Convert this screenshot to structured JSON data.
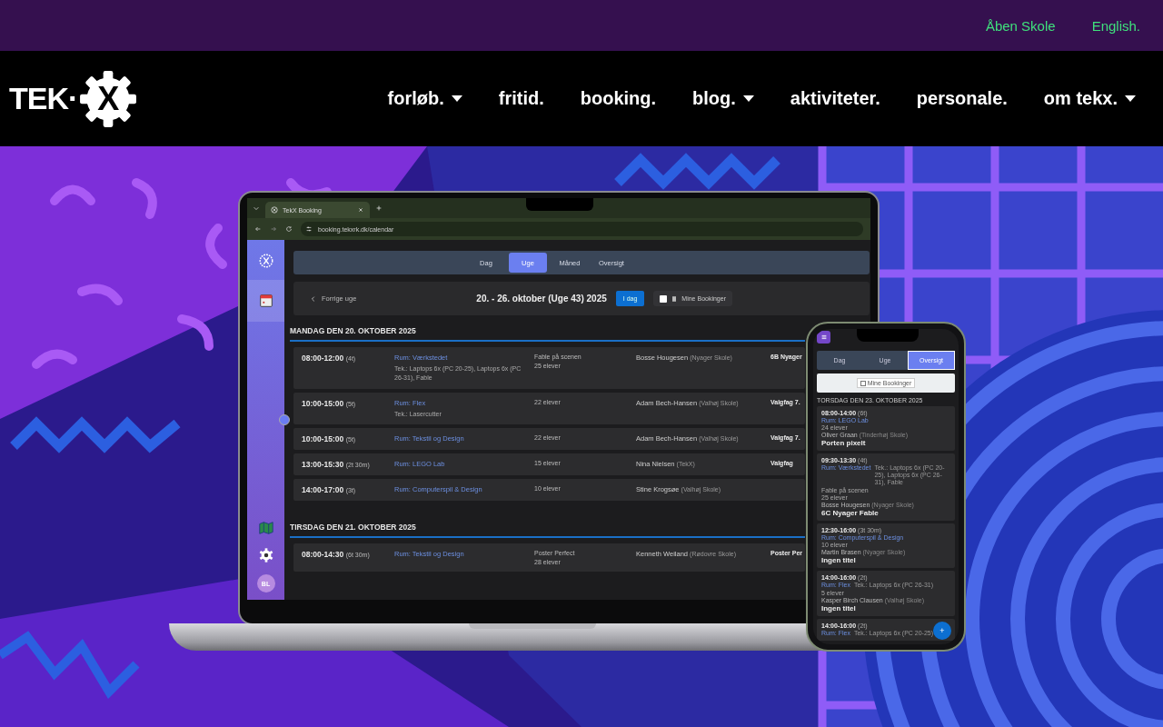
{
  "top_links": [
    "Åben Skole",
    "English."
  ],
  "logo": {
    "prefix": "TEK·",
    "mark": "X"
  },
  "nav": [
    {
      "label": "forløb.",
      "dropdown": true
    },
    {
      "label": "fritid.",
      "dropdown": false
    },
    {
      "label": "booking.",
      "dropdown": false
    },
    {
      "label": "blog.",
      "dropdown": true
    },
    {
      "label": "aktiviteter.",
      "dropdown": false
    },
    {
      "label": "personale.",
      "dropdown": false
    },
    {
      "label": "om tekx.",
      "dropdown": true
    }
  ],
  "laptop": {
    "tab_title": "TekX Booking",
    "url": "booking.tekxrk.dk/calendar",
    "avatar": "BL",
    "view_tabs": [
      {
        "label": "Dag",
        "selected": false
      },
      {
        "label": "Uge",
        "selected": true
      },
      {
        "label": "Måned",
        "selected": false
      },
      {
        "label": "Oversigt",
        "selected": false
      }
    ],
    "prev_week": "Forrige uge",
    "week_title": "20. - 26. oktober (Uge 43) 2025",
    "today_button": "I dag",
    "my_bookings": {
      "label": "Mine Bookinger",
      "checked": false
    },
    "days": [
      {
        "heading": "MANDAG DEN 20. OKTOBER 2025",
        "bookings": [
          {
            "time": "08:00-12:00",
            "duration": "(4t)",
            "room": "Rum: Værkstedet",
            "tech": "Tek.: Laptops 6x (PC 20-25), Laptops 6x (PC 26-31), Fable",
            "note": "Fable på scenen",
            "students": "25 elever",
            "teacher": "Bosse Hougesen",
            "school": "(Nyager Skole)",
            "class": "6B Nyager"
          },
          {
            "time": "10:00-15:00",
            "duration": "(5t)",
            "room": "Rum: Flex",
            "tech": "Tek.: Lasercutter",
            "students": "22 elever",
            "teacher": "Adam Bech-Hansen",
            "school": "(Valhøj Skole)",
            "class": "Valgfag 7."
          },
          {
            "time": "10:00-15:00",
            "duration": "(5t)",
            "room": "Rum: Tekstil og Design",
            "students": "22 elever",
            "teacher": "Adam Bech-Hansen",
            "school": "(Valhøj Skole)",
            "class": "Valgfag 7."
          },
          {
            "time": "13:00-15:30",
            "duration": "(2t 30m)",
            "room": "Rum: LEGO Lab",
            "students": "15 elever",
            "teacher": "Nina Nielsen",
            "school": "(TekX)",
            "class": "Valgfag"
          },
          {
            "time": "14:00-17:00",
            "duration": "(3t)",
            "room": "Rum: Computerspil & Design",
            "students": "10 elever",
            "teacher": "Stine Krogsøe",
            "school": "(Valhøj Skole)"
          }
        ]
      },
      {
        "heading": "TIRSDAG DEN 21. OKTOBER 2025",
        "bookings": [
          {
            "time": "08:00-14:30",
            "duration": "(6t 30m)",
            "room": "Rum: Tekstil og Design",
            "note": "Poster Perfect",
            "students": "28 elever",
            "teacher": "Kenneth Weiland",
            "school": "(Rødovre Skole)",
            "class": "Poster Per"
          }
        ]
      }
    ]
  },
  "phone": {
    "view_tabs": [
      {
        "label": "Dag",
        "selected": false
      },
      {
        "label": "Uge",
        "selected": false
      },
      {
        "label": "Oversigt",
        "selected": true
      }
    ],
    "my_bookings": {
      "label": "Mine Bookinger",
      "checked": false
    },
    "heading": "TORSDAG DEN 23. OKTOBER 2025",
    "bookings": [
      {
        "time": "08:00-14:00",
        "duration": "(6t)",
        "room": "Rum: LEGO Lab",
        "students": "24 elever",
        "teacher": "Oliver Graan",
        "school": "(Tinderhøj Skole)",
        "title": "Porten pixelt"
      },
      {
        "time": "09:30-13:30",
        "duration": "(4t)",
        "room": "Rum: Værkstedet",
        "tech": "Tek.: Laptops 6x (PC 20-25), Laptops 6x (PC 26-31), Fable",
        "note": "Fable på scenen",
        "students": "25 elever",
        "teacher": "Bosse Hougesen",
        "school": "(Nyager Skole)",
        "title": "6C Nyager Fable"
      },
      {
        "time": "12:30-16:00",
        "duration": "(3t 30m)",
        "room": "Rum: Computerspil & Design",
        "students": "10 elever",
        "teacher": "Martin Brasen",
        "school": "(Nyager Skole)",
        "title": "Ingen titel"
      },
      {
        "time": "14:00-16:00",
        "duration": "(2t)",
        "room": "Rum: Flex",
        "tech": "Tek.: Laptops 6x (PC 26-31)",
        "students": "5 elever",
        "teacher": "Kasper Birch Clausen",
        "school": "(Valhøj Skole)",
        "title": "Ingen titel"
      },
      {
        "time": "14:00-16:00",
        "duration": "(2t)",
        "room": "Rum: Flex",
        "tech": "Tek.: Laptops 6x (PC 20-25)"
      }
    ],
    "fab": "+"
  }
}
